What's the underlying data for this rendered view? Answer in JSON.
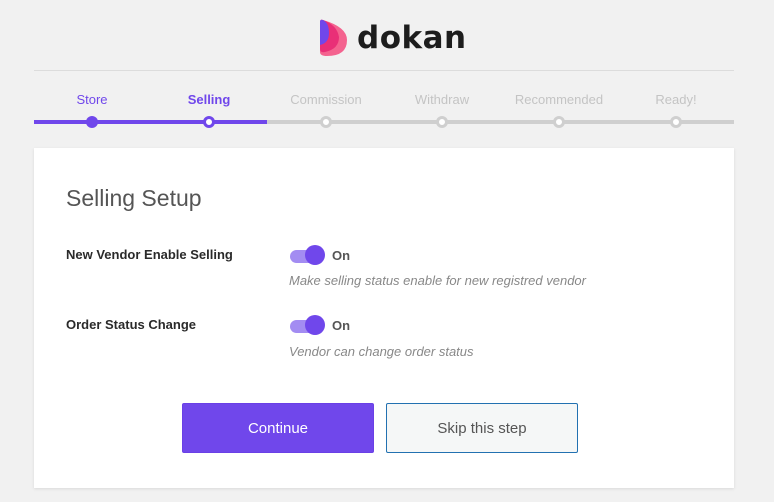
{
  "logo": {
    "text": "dokan"
  },
  "steps": [
    {
      "label": "Store",
      "state": "done"
    },
    {
      "label": "Selling",
      "state": "active"
    },
    {
      "label": "Commission",
      "state": "todo"
    },
    {
      "label": "Withdraw",
      "state": "todo"
    },
    {
      "label": "Recommended",
      "state": "todo"
    },
    {
      "label": "Ready!",
      "state": "todo"
    }
  ],
  "card": {
    "title": "Selling Setup",
    "settings": [
      {
        "label": "New Vendor Enable Selling",
        "state": "On",
        "hint": "Make selling status enable for new registred vendor",
        "enabled": true
      },
      {
        "label": "Order Status Change",
        "state": "On",
        "hint": "Vendor can change order status",
        "enabled": true
      }
    ],
    "continue_label": "Continue",
    "skip_label": "Skip this step"
  },
  "colors": {
    "accent": "#7047eb",
    "toggle_track": "#a38cf2",
    "inactive": "#cfcfcf"
  }
}
